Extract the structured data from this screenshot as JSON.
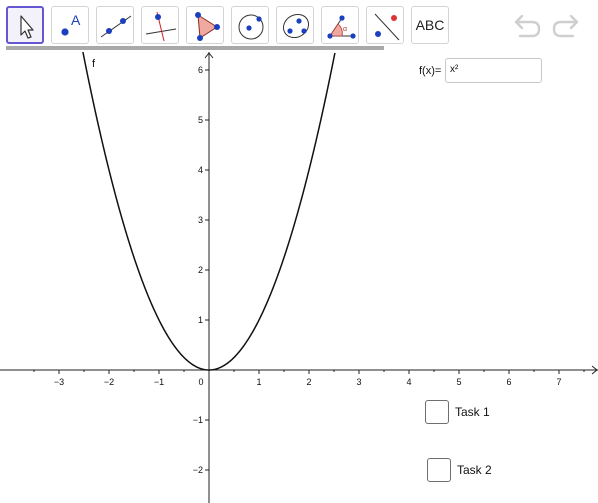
{
  "toolbar": {
    "tools": [
      {
        "name": "move-tool",
        "icon": "arrow-cursor-icon",
        "selected": true
      },
      {
        "name": "point-tool",
        "icon": "point-icon",
        "label": "A"
      },
      {
        "name": "line-tool",
        "icon": "line-through-points-icon"
      },
      {
        "name": "perpendicular-line-tool",
        "icon": "perpendicular-line-icon"
      },
      {
        "name": "polygon-tool",
        "icon": "polygon-icon"
      },
      {
        "name": "circle-tool",
        "icon": "circle-center-point-icon"
      },
      {
        "name": "ellipse-tool",
        "icon": "ellipse-icon"
      },
      {
        "name": "angle-tool",
        "icon": "angle-icon",
        "label": "α"
      },
      {
        "name": "reflect-tool",
        "icon": "reflect-about-line-icon"
      },
      {
        "name": "text-tool",
        "icon": "text-icon",
        "label": "ABC"
      }
    ],
    "undo_icon": "undo-icon",
    "redo_icon": "redo-icon"
  },
  "input_bar": {
    "label": "f(x)=",
    "value": "x²"
  },
  "graph": {
    "function_label": "f",
    "x_ticks": [
      "−3",
      "−2",
      "−1",
      "0",
      "1",
      "2",
      "3",
      "4",
      "5",
      "6",
      "7"
    ],
    "y_ticks_positive": [
      "1",
      "2",
      "3",
      "4",
      "5",
      "6"
    ],
    "y_ticks_negative": [
      "−1",
      "−2"
    ]
  },
  "tasks": [
    {
      "label": "Task 1",
      "checked": false
    },
    {
      "label": "Task 2",
      "checked": false
    }
  ],
  "colors": {
    "accent": "#6557d2",
    "point_blue": "#1a3fbf",
    "polygon_fill": "#f0a9a0",
    "tool_line_red": "#cc2222"
  },
  "chart_data": {
    "type": "line",
    "series": [
      {
        "name": "f",
        "formula": "x^2"
      }
    ],
    "xlim": [
      -4,
      8
    ],
    "ylim": [
      -2.5,
      6.3
    ],
    "x_ticks": [
      -3,
      -2,
      -1,
      0,
      1,
      2,
      3,
      4,
      5,
      6,
      7
    ],
    "y_ticks": [
      -2,
      -1,
      1,
      2,
      3,
      4,
      5,
      6
    ],
    "grid": false
  }
}
